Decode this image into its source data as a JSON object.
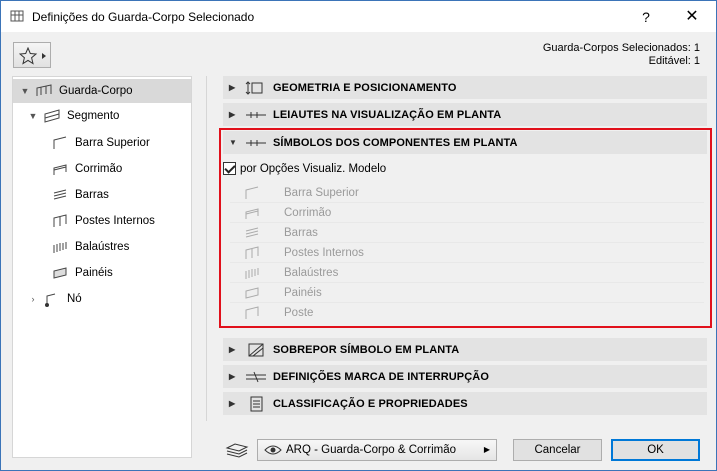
{
  "window": {
    "title": "Definições do Guarda-Corpo Selecionado",
    "help_label": "?",
    "close_label": "✕"
  },
  "info": {
    "line1": "Guarda-Corpos Selecionados: 1",
    "line2": "Editável: 1"
  },
  "tree": {
    "root": "Guarda-Corpo",
    "segment": "Segmento",
    "children": [
      "Barra Superior",
      "Corrimão",
      "Barras",
      "Postes Internos",
      "Balaústres",
      "Painéis"
    ],
    "node": "Nó"
  },
  "sections": {
    "s1": "GEOMETRIA E POSICIONAMENTO",
    "s2": "LEIAUTES NA VISUALIZAÇÃO EM PLANTA",
    "s3": "SÍMBOLOS DOS COMPONENTES EM PLANTA",
    "s4": "SOBREPOR SÍMBOLO EM PLANTA",
    "s5": "DEFINIÇÕES MARCA DE INTERRUPÇÃO",
    "s6": "CLASSIFICAÇÃO E PROPRIEDADES"
  },
  "expanded": {
    "checkbox_label": "por Opções Visualiz. Modelo",
    "checked": true,
    "items": [
      "Barra Superior",
      "Corrimão",
      "Barras",
      "Postes Internos",
      "Balaústres",
      "Painéis",
      "Poste"
    ]
  },
  "footer": {
    "combo_value": "ARQ - Guarda-Corpo & Corrimão",
    "cancel_label": "Cancelar",
    "ok_label": "OK"
  },
  "colors": {
    "highlight_border": "#e1101b",
    "accent": "#0078d7"
  }
}
